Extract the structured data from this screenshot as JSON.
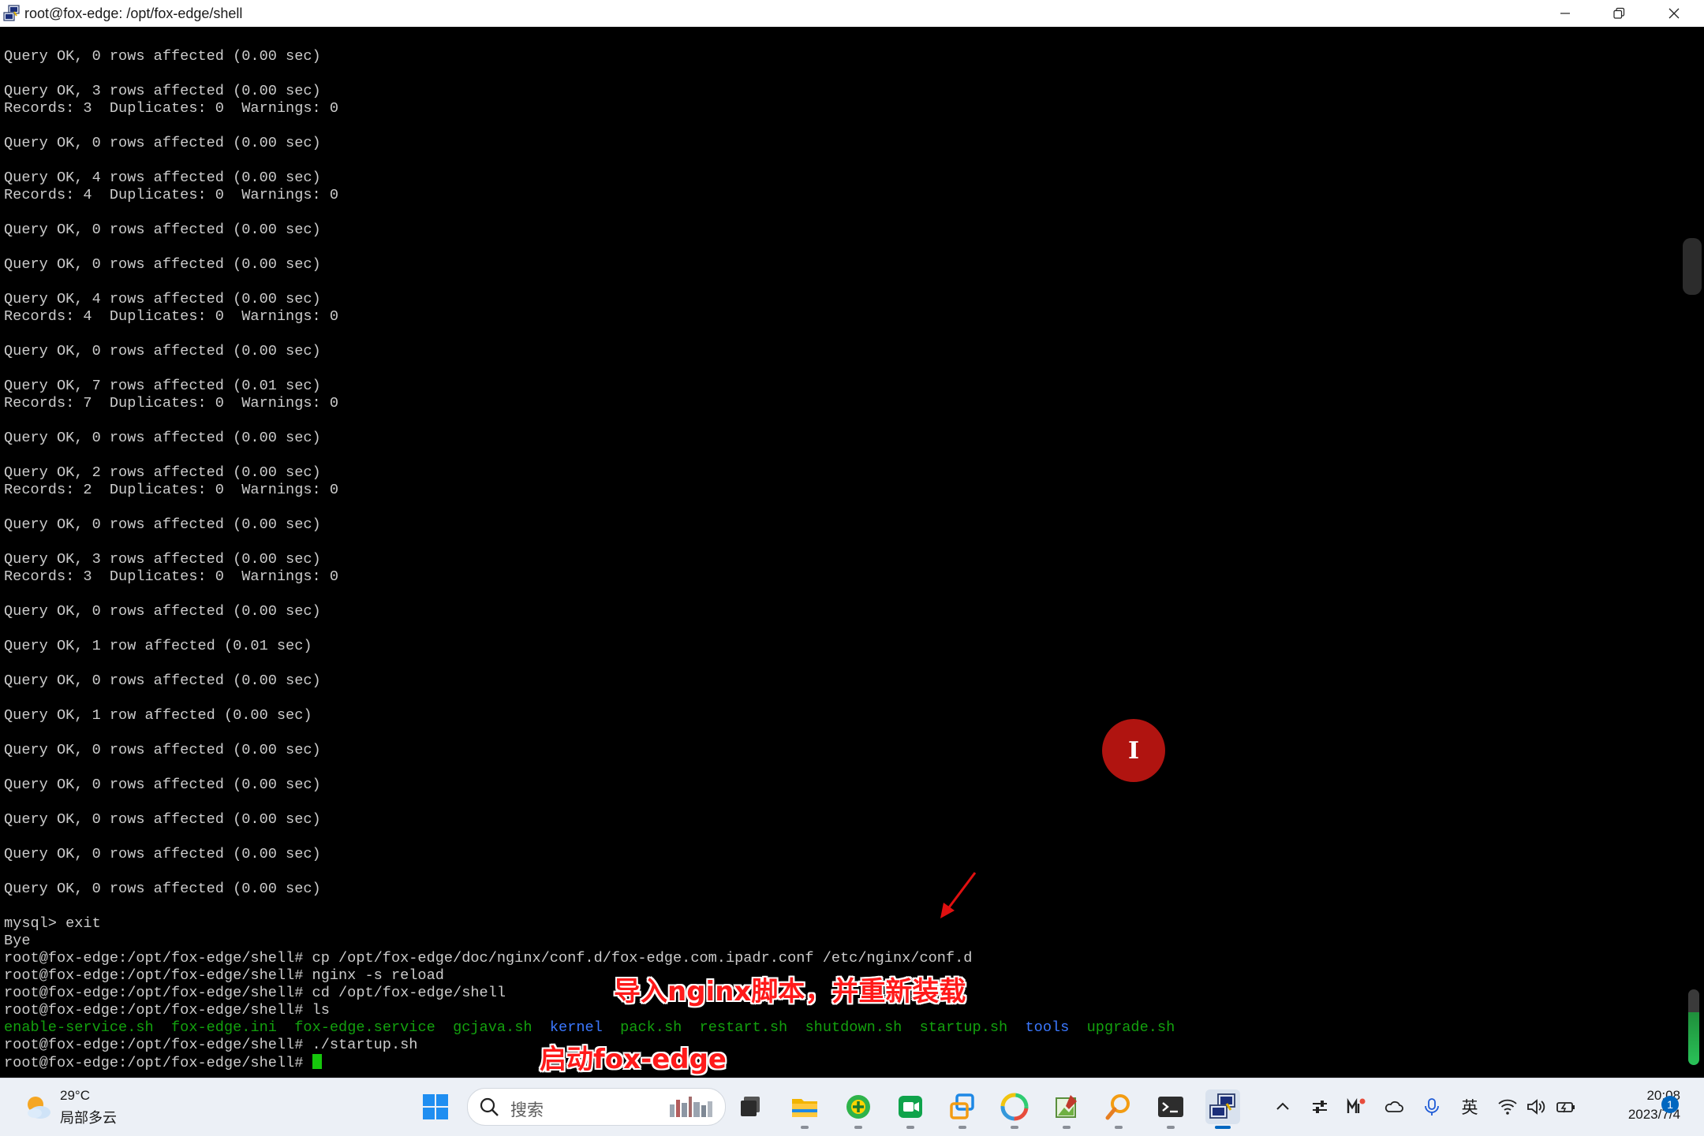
{
  "window": {
    "title": "root@fox-edge: /opt/fox-edge/shell"
  },
  "terminal": {
    "lines": [
      [
        {
          "t": "Query OK, 0 rows affected (0.00 sec)"
        }
      ],
      [],
      [
        {
          "t": "Query OK, 3 rows affected (0.00 sec)"
        }
      ],
      [
        {
          "t": "Records: 3  Duplicates: 0  Warnings: 0"
        }
      ],
      [],
      [
        {
          "t": "Query OK, 0 rows affected (0.00 sec)"
        }
      ],
      [],
      [
        {
          "t": "Query OK, 4 rows affected (0.00 sec)"
        }
      ],
      [
        {
          "t": "Records: 4  Duplicates: 0  Warnings: 0"
        }
      ],
      [],
      [
        {
          "t": "Query OK, 0 rows affected (0.00 sec)"
        }
      ],
      [],
      [
        {
          "t": "Query OK, 0 rows affected (0.00 sec)"
        }
      ],
      [],
      [
        {
          "t": "Query OK, 4 rows affected (0.00 sec)"
        }
      ],
      [
        {
          "t": "Records: 4  Duplicates: 0  Warnings: 0"
        }
      ],
      [],
      [
        {
          "t": "Query OK, 0 rows affected (0.00 sec)"
        }
      ],
      [],
      [
        {
          "t": "Query OK, 7 rows affected (0.01 sec)"
        }
      ],
      [
        {
          "t": "Records: 7  Duplicates: 0  Warnings: 0"
        }
      ],
      [],
      [
        {
          "t": "Query OK, 0 rows affected (0.00 sec)"
        }
      ],
      [],
      [
        {
          "t": "Query OK, 2 rows affected (0.00 sec)"
        }
      ],
      [
        {
          "t": "Records: 2  Duplicates: 0  Warnings: 0"
        }
      ],
      [],
      [
        {
          "t": "Query OK, 0 rows affected (0.00 sec)"
        }
      ],
      [],
      [
        {
          "t": "Query OK, 3 rows affected (0.00 sec)"
        }
      ],
      [
        {
          "t": "Records: 3  Duplicates: 0  Warnings: 0"
        }
      ],
      [],
      [
        {
          "t": "Query OK, 0 rows affected (0.00 sec)"
        }
      ],
      [],
      [
        {
          "t": "Query OK, 1 row affected (0.01 sec)"
        }
      ],
      [],
      [
        {
          "t": "Query OK, 0 rows affected (0.00 sec)"
        }
      ],
      [],
      [
        {
          "t": "Query OK, 1 row affected (0.00 sec)"
        }
      ],
      [],
      [
        {
          "t": "Query OK, 0 rows affected (0.00 sec)"
        }
      ],
      [],
      [
        {
          "t": "Query OK, 0 rows affected (0.00 sec)"
        }
      ],
      [],
      [
        {
          "t": "Query OK, 0 rows affected (0.00 sec)"
        }
      ],
      [],
      [
        {
          "t": "Query OK, 0 rows affected (0.00 sec)"
        }
      ],
      [],
      [
        {
          "t": "Query OK, 0 rows affected (0.00 sec)"
        }
      ],
      [],
      [
        {
          "t": "mysql> exit"
        }
      ],
      [
        {
          "t": "Bye"
        }
      ],
      [
        {
          "t": "root@fox-edge:/opt/fox-edge/shell# cp /opt/fox-edge/doc/nginx/conf.d/fox-edge.com.ipadr.conf /etc/nginx/conf.d"
        }
      ],
      [
        {
          "t": "root@fox-edge:/opt/fox-edge/shell# nginx -s reload"
        }
      ],
      [
        {
          "t": "root@fox-edge:/opt/fox-edge/shell# cd /opt/fox-edge/shell"
        }
      ],
      [
        {
          "t": "root@fox-edge:/opt/fox-edge/shell# ls"
        }
      ],
      [
        {
          "t": "enable-service.sh",
          "c": "exec"
        },
        {
          "t": "  "
        },
        {
          "t": "fox-edge.ini",
          "c": "exec"
        },
        {
          "t": "  "
        },
        {
          "t": "fox-edge.service",
          "c": "exec"
        },
        {
          "t": "  "
        },
        {
          "t": "gcjava.sh",
          "c": "exec"
        },
        {
          "t": "  "
        },
        {
          "t": "kernel",
          "c": "dir"
        },
        {
          "t": "  "
        },
        {
          "t": "pack.sh",
          "c": "exec"
        },
        {
          "t": "  "
        },
        {
          "t": "restart.sh",
          "c": "exec"
        },
        {
          "t": "  "
        },
        {
          "t": "shutdown.sh",
          "c": "exec"
        },
        {
          "t": "  "
        },
        {
          "t": "startup.sh",
          "c": "exec"
        },
        {
          "t": "  "
        },
        {
          "t": "tools",
          "c": "dir"
        },
        {
          "t": "  "
        },
        {
          "t": "upgrade.sh",
          "c": "exec"
        }
      ],
      [
        {
          "t": "root@fox-edge:/opt/fox-edge/shell# ./startup.sh"
        }
      ],
      [
        {
          "t": "root@fox-edge:/opt/fox-edge/shell# "
        },
        {
          "cursor": true
        }
      ]
    ]
  },
  "annotations": {
    "nginx_note": "导入nginx脚本，并重新装载",
    "start_note": "启动fox-edge"
  },
  "click_indicator": {
    "icon": "i-beam-cursor-icon",
    "color": "#b01410"
  },
  "taskbar": {
    "weather_temp": "29°C",
    "weather_desc": "局部多云",
    "search_placeholder": "搜索",
    "apps": [
      "file-explorer-icon",
      "app-plus-icon",
      "meeting-icon",
      "remote-app-icon",
      "photos-icon",
      "paint-icon",
      "search-tool-icon",
      "terminal-icon",
      "putty-icon"
    ],
    "tray_ime": "英",
    "clock_time": "20:08",
    "clock_date": "2023/7/4",
    "notification_count": "1"
  },
  "colors": {
    "terminal_bg": "#000000",
    "terminal_fg": "#cccccc",
    "ls_exec": "#13a10e",
    "ls_dir": "#3b78ff",
    "cursor": "#16c60c",
    "annotation": "#ff1a1a"
  }
}
